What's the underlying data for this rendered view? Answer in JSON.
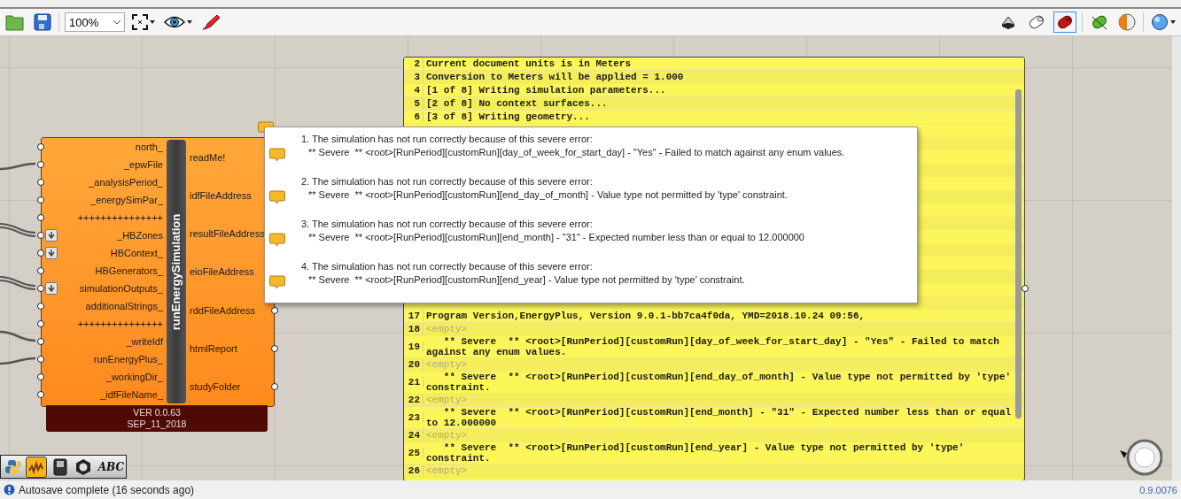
{
  "toolbar": {
    "zoom": "100%"
  },
  "component": {
    "title": "runEnergySimulation",
    "version": "VER 0.0.63",
    "date": "SEP_11_2018",
    "inputs": [
      {
        "name": "north_",
        "list_access": false,
        "kind": "unwired"
      },
      {
        "name": "_epwFile",
        "list_access": false,
        "kind": "wired"
      },
      {
        "name": "_analysisPeriod_",
        "list_access": false,
        "kind": "unwired"
      },
      {
        "name": "_energySimPar_",
        "list_access": false,
        "kind": "unwired"
      },
      {
        "name": "+++++++++++++++",
        "list_access": false,
        "kind": "unwired"
      },
      {
        "name": "_HBZones",
        "list_access": true,
        "kind": "tree"
      },
      {
        "name": "HBContext_",
        "list_access": true,
        "kind": "unwired"
      },
      {
        "name": "HBGenerators_",
        "list_access": false,
        "kind": "unwired"
      },
      {
        "name": "simulationOutputs_",
        "list_access": true,
        "kind": "tree"
      },
      {
        "name": "additionalStrings_",
        "list_access": false,
        "kind": "unwired"
      },
      {
        "name": "+++++++++++++++",
        "list_access": false,
        "kind": "unwired"
      },
      {
        "name": "_writeIdf",
        "list_access": false,
        "kind": "wired"
      },
      {
        "name": "runEnergyPlus_",
        "list_access": false,
        "kind": "wired"
      },
      {
        "name": "_workingDir_",
        "list_access": false,
        "kind": "unwired"
      },
      {
        "name": "_idfFileName_",
        "list_access": false,
        "kind": "unwired"
      }
    ],
    "outputs": [
      {
        "name": "readMe!"
      },
      {
        "name": "idfFileAddress"
      },
      {
        "name": "resultFileAddress"
      },
      {
        "name": "eioFileAddress"
      },
      {
        "name": "rddFileAddress"
      },
      {
        "name": "htmlReport"
      },
      {
        "name": "studyFolder"
      }
    ]
  },
  "tooltip": {
    "messages": [
      {
        "title": "1. The simulation has not run correctly because of this severe error:",
        "detail": "** Severe  ** <root>[RunPeriod][customRun][day_of_week_for_start_day] - \"Yes\" - Failed to match against any enum values."
      },
      {
        "title": "2. The simulation has not run correctly because of this severe error:",
        "detail": "** Severe  ** <root>[RunPeriod][customRun][end_day_of_month] - Value type not permitted by 'type' constraint."
      },
      {
        "title": "3. The simulation has not run correctly because of this severe error:",
        "detail": "** Severe  ** <root>[RunPeriod][customRun][end_month] - \"31\" - Expected number less than or equal to 12.000000"
      },
      {
        "title": "4. The simulation has not run correctly because of this severe error:",
        "detail": "** Severe  ** <root>[RunPeriod][customRun][end_year] - Value type not permitted by 'type' constraint."
      }
    ]
  },
  "panel": {
    "lines_top": [
      {
        "number": "2",
        "kind": "text",
        "text": "Current document units is in Meters"
      },
      {
        "number": "3",
        "kind": "text",
        "text": "Conversion to Meters will be applied = 1.000"
      },
      {
        "number": "4",
        "kind": "text",
        "text": "[1 of 8] Writing simulation parameters..."
      },
      {
        "number": "5",
        "kind": "text",
        "text": "[2 of 8] No context surfaces..."
      },
      {
        "number": "6",
        "kind": "text",
        "text": "[3 of 8] Writing geometry..."
      }
    ],
    "lines_bottom": [
      {
        "number": "17",
        "kind": "text",
        "text": "Program Version,EnergyPlus, Version 9.0.1-bb7ca4f0da, YMD=2018.10.24 09:56,"
      },
      {
        "number": "18",
        "kind": "empty",
        "text": "<empty>"
      },
      {
        "number": "19",
        "kind": "text",
        "text": "   ** Severe  ** <root>[RunPeriod][customRun][day_of_week_for_start_day] - \"Yes\" - Failed to match against any enum values."
      },
      {
        "number": "20",
        "kind": "empty",
        "text": "<empty>"
      },
      {
        "number": "21",
        "kind": "text",
        "text": "   ** Severe  ** <root>[RunPeriod][customRun][end_day_of_month] - Value type not permitted by 'type' constraint."
      },
      {
        "number": "22",
        "kind": "empty",
        "text": "<empty>"
      },
      {
        "number": "23",
        "kind": "text",
        "text": "   ** Severe  ** <root>[RunPeriod][customRun][end_month] - \"31\" - Expected number less than or equal to 12.000000"
      },
      {
        "number": "24",
        "kind": "empty",
        "text": "<empty>"
      },
      {
        "number": "25",
        "kind": "text",
        "text": "   ** Severe  ** <root>[RunPeriod][customRun][end_year] - Value type not permitted by 'type' constraint."
      },
      {
        "number": "26",
        "kind": "empty",
        "text": "<empty>"
      }
    ]
  },
  "widget_bar": {
    "abc_label": "ABC"
  },
  "status_bar": {
    "message": "Autosave complete (16 seconds ago)",
    "version": "0.9.0076"
  }
}
